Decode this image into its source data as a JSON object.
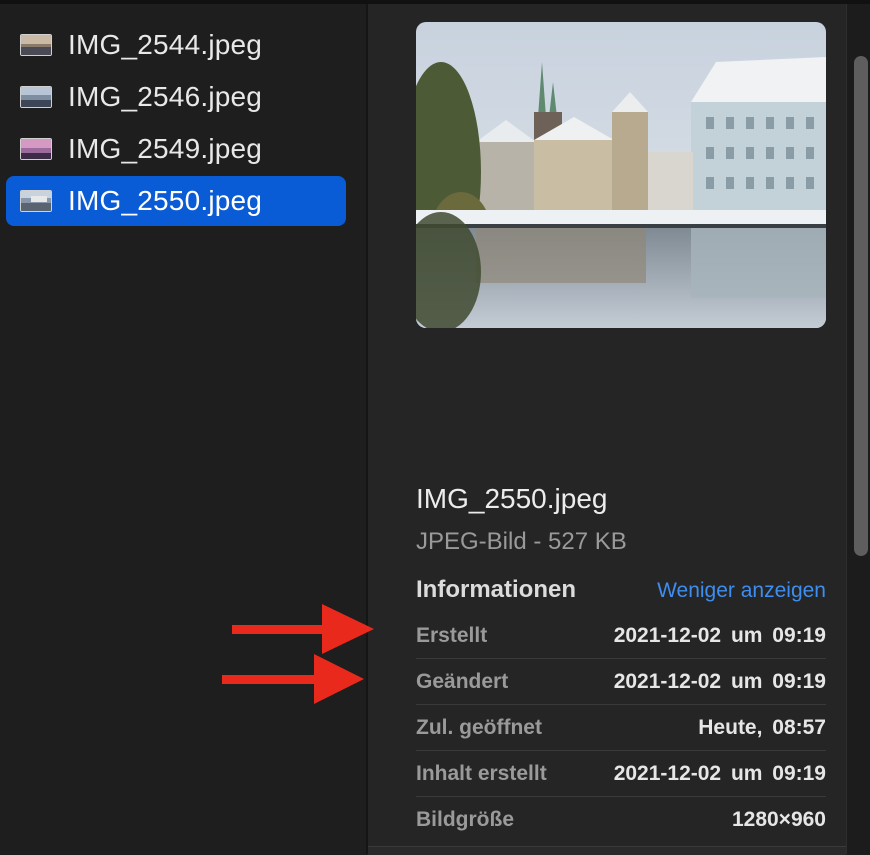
{
  "files": [
    {
      "name": "IMG_2544.jpeg",
      "selected": false
    },
    {
      "name": "IMG_2546.jpeg",
      "selected": false
    },
    {
      "name": "IMG_2549.jpeg",
      "selected": false
    },
    {
      "name": "IMG_2550.jpeg",
      "selected": true
    }
  ],
  "preview": {
    "filename": "IMG_2550.jpeg",
    "kind_size": "JPEG-Bild - 527 KB",
    "info_heading": "Informationen",
    "toggle_label": "Weniger anzeigen",
    "rows": [
      {
        "label": "Erstellt",
        "value": "2021-12-02  um 09:19"
      },
      {
        "label": "Geändert",
        "value": "2021-12-02  um 09:19"
      },
      {
        "label": "Zul. geöffnet",
        "value": "Heute, 08:57"
      },
      {
        "label": "Inhalt erstellt",
        "value": "2021-12-02  um 09:19"
      },
      {
        "label": "Bildgröße",
        "value": "1280×960"
      }
    ]
  },
  "colors": {
    "selection": "#0a5bd6",
    "link": "#3d8ef0",
    "arrow": "#e8291c"
  }
}
